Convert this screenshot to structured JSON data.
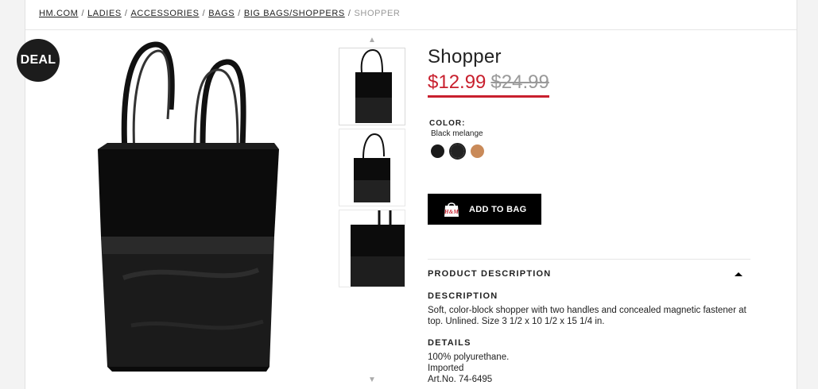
{
  "breadcrumb": {
    "items": [
      "HM.COM",
      "LADIES",
      "ACCESSORIES",
      "BAGS",
      "BIG BAGS/SHOPPERS"
    ],
    "current": "SHOPPER",
    "separator": "/"
  },
  "badge": {
    "label": "DEAL"
  },
  "product": {
    "title": "Shopper",
    "sale_price": "$12.99",
    "original_price": "$24.99"
  },
  "color": {
    "label": "COLOR:",
    "selected_name": "Black melange",
    "swatches": [
      {
        "name": "black",
        "hex": "#1a1a1a"
      },
      {
        "name": "black-melange",
        "hex": "#222222"
      },
      {
        "name": "cognac",
        "hex": "#c98a59"
      }
    ]
  },
  "cart": {
    "add_label": "ADD TO BAG",
    "bag_logo": "H&M"
  },
  "description": {
    "section_title": "PRODUCT DESCRIPTION",
    "description_heading": "DESCRIPTION",
    "description_text": "Soft, color-block shopper with two handles and concealed magnetic fastener at top. Unlined. Size 3 1/2 x 10 1/2 x 15 1/4 in.",
    "details_heading": "DETAILS",
    "details_lines": [
      "100% polyurethane.",
      "Imported",
      "Art.No. 74-6495"
    ]
  },
  "colors": {
    "sale": "#c8202e",
    "button": "#000000"
  }
}
